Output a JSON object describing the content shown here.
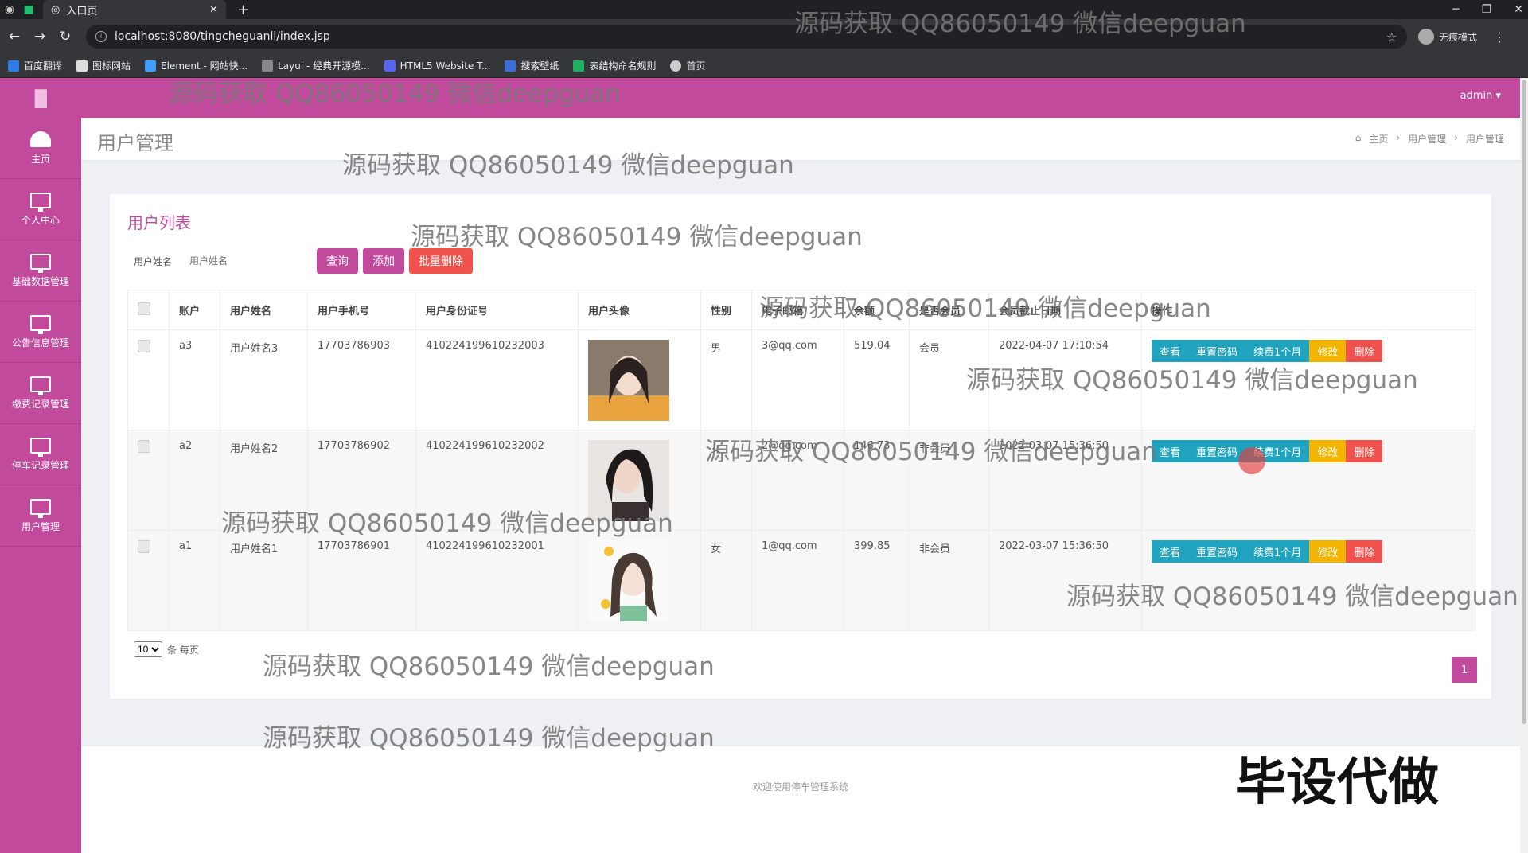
{
  "browser": {
    "tab_title": "入口页",
    "url": "localhost:8080/tingcheguanli/index.jsp",
    "incognito_label": "无痕模式",
    "bookmarks": [
      "百度翻译",
      "图标网站",
      "Element - 网站快...",
      "Layui - 经典开源模...",
      "HTML5 Website T...",
      "搜索壁纸",
      "表结构命名规则",
      "首页"
    ]
  },
  "header": {
    "user": "admin ▾"
  },
  "sidebar": {
    "items": [
      {
        "label": "主页",
        "icon": "dashboard-icon"
      },
      {
        "label": "个人中心",
        "icon": "monitor-icon"
      },
      {
        "label": "基础数据管理",
        "icon": "monitor-icon"
      },
      {
        "label": "公告信息管理",
        "icon": "monitor-icon"
      },
      {
        "label": "缴费记录管理",
        "icon": "monitor-icon"
      },
      {
        "label": "停车记录管理",
        "icon": "monitor-icon"
      },
      {
        "label": "用户管理",
        "icon": "monitor-icon"
      }
    ]
  },
  "page": {
    "title": "用户管理",
    "breadcrumb": [
      "主页",
      "用户管理",
      "用户管理"
    ]
  },
  "panel": {
    "title": "用户列表",
    "search_label": "用户姓名",
    "search_placeholder": "用户姓名",
    "btn_query": "查询",
    "btn_add": "添加",
    "btn_batch_delete": "批量删除"
  },
  "table": {
    "headers": [
      "账户",
      "用户姓名",
      "用户手机号",
      "用户身份证号",
      "用户头像",
      "性别",
      "电子邮箱",
      "余额",
      "是否会员",
      "会员截止日期",
      "操作"
    ],
    "rows": [
      {
        "account": "a3",
        "name": "用户姓名3",
        "phone": "17703786903",
        "id_card": "410224199610232003",
        "gender": "男",
        "email": "3@qq.com",
        "balance": "519.04",
        "member": "会员",
        "expire": "2022-04-07 17:10:54"
      },
      {
        "account": "a2",
        "name": "用户姓名2",
        "phone": "17703786902",
        "id_card": "410224199610232002",
        "gender": "女",
        "email": "2@qq.com",
        "balance": "146.73",
        "member": "非会员",
        "expire": "2022-03-07 15:36:50"
      },
      {
        "account": "a1",
        "name": "用户姓名1",
        "phone": "17703786901",
        "id_card": "410224199610232001",
        "gender": "女",
        "email": "1@qq.com",
        "balance": "399.85",
        "member": "非会员",
        "expire": "2022-03-07 15:36:50"
      }
    ],
    "ops": {
      "view": "查看",
      "reset": "重置密码",
      "renew": "续费1个月",
      "edit": "修改",
      "delete": "删除"
    }
  },
  "pager": {
    "page_size": "10",
    "per_page_text": "条 每页",
    "current": "1"
  },
  "footer": {
    "text": "欢迎使用停车管理系统"
  },
  "watermark": {
    "text": "源码获取 QQ86050149 微信deepguan",
    "big": "毕设代做"
  },
  "colors": {
    "brand": "#c24a9c",
    "info": "#1fa3bf",
    "warning": "#f5b400",
    "danger": "#f1524d"
  }
}
